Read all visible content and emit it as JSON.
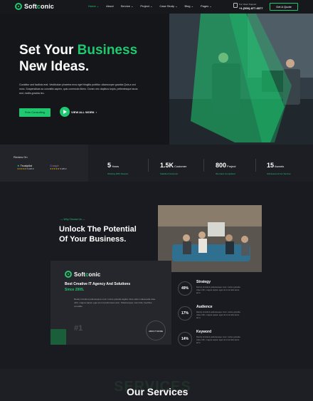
{
  "brand": {
    "prefix": "Soft",
    "accent_letter": "c",
    "suffix": "onic"
  },
  "nav": {
    "items": [
      {
        "label": "Home ⌄",
        "active": true
      },
      {
        "label": "About"
      },
      {
        "label": "Service ⌄"
      },
      {
        "label": "Project ⌄"
      },
      {
        "label": "Case Study ⌄"
      },
      {
        "label": "Blog ⌄"
      },
      {
        "label": "Pages ⌄"
      }
    ],
    "support_label": "For Client Support",
    "support_phone": "+1-(500)-877-6577",
    "cta": "Get A Quote"
  },
  "hero": {
    "title_line1_a": "Set Your ",
    "title_line1_b": "Business",
    "title_line2": "New Ideas.",
    "paragraph": "Curabitur sed facilisis erat. Vestibulum pharetra eros eget fringilla porttitor. ullamcorper gravida Quis a orci nunc. Suspendisse ac convallis sapien, quis commodo libero. Donec nec dapibus turpis, pellentesque lacus sed, mollis gravida leo.",
    "primary_button": "Free Consulting",
    "video_label": "VIEW ALL WORK"
  },
  "reviews": {
    "title": "Review On",
    "items": [
      {
        "name": "Trustpilot",
        "stars": "★★★★★",
        "score": "5.0/5.0"
      },
      {
        "name": "Google",
        "stars": "★★★★★",
        "score": "5.0/5.0"
      }
    ]
  },
  "stats": [
    {
      "num": "5",
      "unit": "Years",
      "sub": "Working With Passion"
    },
    {
      "num": "1.5K",
      "unit": "Customer",
      "sub": "Satisfied Customer"
    },
    {
      "num": "800",
      "unit": "Project",
      "sub": "We Have Completed"
    },
    {
      "num": "15",
      "unit": "Awards",
      "sub": "Achievement For Service"
    }
  ],
  "about": {
    "kicker": "Why Choose Us",
    "title": "Unlock The Potential Of Your Business.",
    "card_heading": "Best Creative IT Agency And Solutions",
    "card_since": "Since 2005.",
    "card_paragraph": "Randy tincidunt pellentesque nunc. luctus gravida sagitta. Duis etiam malesuada vitae nibh, magna sapien eget sit urna felis lacus arcu. Pellentesque nunc felis, faucibus convallis.",
    "card_number": "#1",
    "more_button": "ABOUT MORE",
    "metrics": [
      {
        "value": "49%",
        "title": "Strategy",
        "text": "Randy tincidunt pellentesque nunc. luctus gravida vitae nibh, magna sapien eget sit urna felis lacus arcu."
      },
      {
        "value": "17%",
        "title": "Audience",
        "text": "Randy tincidunt pellentesque nunc. luctus gravida vitae nibh, magna sapien eget sit urna felis lacus arcu."
      },
      {
        "value": "14%",
        "title": "Keyword",
        "text": "Randy tincidunt pellentesque nunc. luctus gravida vitae nibh, magna sapien eget sit urna felis lacus arcu."
      }
    ]
  },
  "services": {
    "shadow": "SERVICES",
    "title": "Our Services"
  },
  "colors": {
    "accent": "#1ec96f",
    "bg": "#1a1b20",
    "card": "#26272c"
  },
  "icons": [
    "logo-icon",
    "phone-icon",
    "play-icon",
    "star-icon",
    "google-icon",
    "trustpilot-icon",
    "arrow-icon"
  ]
}
